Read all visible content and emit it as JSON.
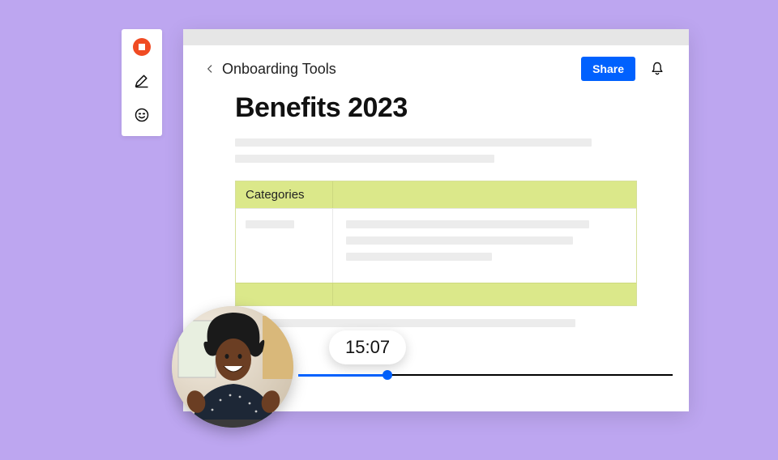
{
  "toolbar": {
    "record_icon": "record-icon",
    "pen_icon": "pen-icon",
    "emoji_icon": "emoji-icon"
  },
  "header": {
    "back_icon": "chevron-left-icon",
    "breadcrumb": "Onboarding Tools",
    "share_label": "Share",
    "bell_icon": "bell-icon"
  },
  "document": {
    "title": "Benefits 2023",
    "table_header": "Categories"
  },
  "recording": {
    "time": "15:07"
  },
  "colors": {
    "accent_blue": "#0061fe",
    "accent_lime": "#dbe88a",
    "record_red": "#f04b23",
    "background_purple": "#bda6f0"
  }
}
